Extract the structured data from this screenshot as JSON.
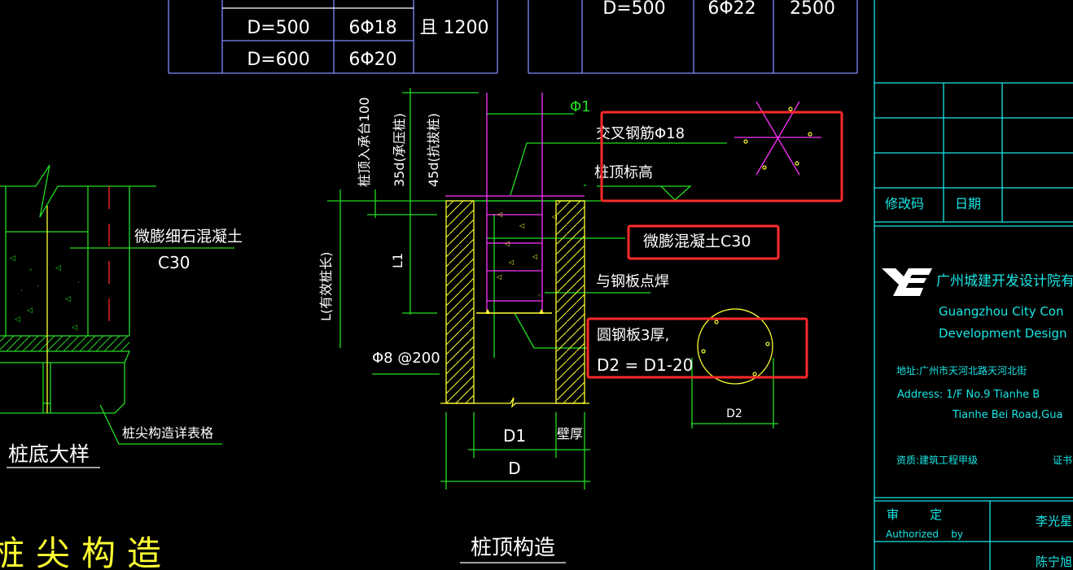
{
  "colors": {
    "background": "#000000",
    "table_line": "#7f8cff",
    "dim_line": "#22dd22",
    "pile_wall": "#ffff33",
    "rebar": "#ff33ff",
    "highlight_box": "#ff2a2a",
    "title_block": "#19e6e6",
    "text": "#ffffff",
    "axis_line": "#ff2222"
  },
  "table_left": {
    "rows": [
      {
        "d": "D=500",
        "rebar": "6Φ18"
      },
      {
        "d": "D=600",
        "rebar": "6Φ20"
      }
    ],
    "merged_cell": "且 1200"
  },
  "table_right": {
    "rows": [
      {
        "d": "D=500",
        "rebar": "6Φ22",
        "value": "2500"
      }
    ]
  },
  "pile_bottom_detail": {
    "concrete_label": "微膨细石混凝土",
    "concrete_grade": "C30",
    "tip_table_ref": "桩尖构造详表格",
    "title": "桩底大样",
    "section_title": "桩尖构造"
  },
  "pile_top_detail": {
    "dim_embed": "桩顶入承台100",
    "dim_35d": "35d(承压桩)",
    "dim_45d": "45d(抗拔桩)",
    "phi1": "Φ1",
    "cross_rebar": "交叉钢筋Φ18",
    "pile_top_elevation": "桩顶标高",
    "micro_concrete": "微膨混凝土C30",
    "spot_weld": "与钢板点焊",
    "steel_plate": "圆钢板3厚,",
    "d2_formula": "D2 = D1-20",
    "stirrup": "Φ8 @200",
    "l1": "L1",
    "l_effective": "L(有效桩长)",
    "d1": "D1",
    "wall_thickness": "壁厚",
    "d": "D",
    "d2": "D2",
    "title": "桩顶构造"
  },
  "title_block": {
    "revision_code": "修改码",
    "date": "日期",
    "company_cn": "广州城建开发设计院有限公",
    "company_en_1": "Guangzhou  City  Con",
    "company_en_2": "Development  Design",
    "address_cn": "地址:广州市天河北路天河北街",
    "address_en_1": "Address:  1/F  No.9  Tianhe  B",
    "address_en_2": "Tianhe  Bei  Road,Gua",
    "qualification": "资质:建筑工程甲级",
    "cert_no": "证书号",
    "authorized_cn": "审        定",
    "authorized_en": "Authorized    by",
    "authorized_name": "李光星",
    "second_name": "陈宁旭"
  }
}
